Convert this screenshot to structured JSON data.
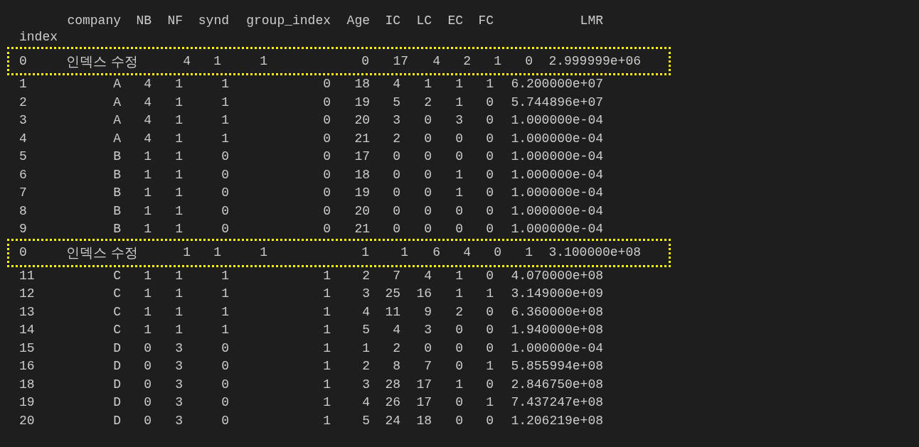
{
  "table": {
    "columns": [
      "company",
      "NB",
      "NF",
      "synd",
      "group_index",
      "Age",
      "IC",
      "LC",
      "EC",
      "FC",
      "LMR"
    ],
    "index_name": "index",
    "rows": [
      {
        "kind": "edited",
        "index": "0",
        "cells": [
          "인덱스 수정",
          "4",
          "1",
          "1",
          "0",
          "17",
          "4",
          "2",
          "1",
          "0",
          "2.999999e+06"
        ]
      },
      {
        "kind": "data",
        "index": "1",
        "cells": [
          "A",
          "4",
          "1",
          "1",
          "0",
          "18",
          "4",
          "1",
          "1",
          "1",
          "6.200000e+07"
        ]
      },
      {
        "kind": "data",
        "index": "2",
        "cells": [
          "A",
          "4",
          "1",
          "1",
          "0",
          "19",
          "5",
          "2",
          "1",
          "0",
          "5.744896e+07"
        ]
      },
      {
        "kind": "data",
        "index": "3",
        "cells": [
          "A",
          "4",
          "1",
          "1",
          "0",
          "20",
          "3",
          "0",
          "3",
          "0",
          "1.000000e-04"
        ]
      },
      {
        "kind": "data",
        "index": "4",
        "cells": [
          "A",
          "4",
          "1",
          "1",
          "0",
          "21",
          "2",
          "0",
          "0",
          "0",
          "1.000000e-04"
        ]
      },
      {
        "kind": "data",
        "index": "5",
        "cells": [
          "B",
          "1",
          "1",
          "0",
          "0",
          "17",
          "0",
          "0",
          "0",
          "0",
          "1.000000e-04"
        ]
      },
      {
        "kind": "data",
        "index": "6",
        "cells": [
          "B",
          "1",
          "1",
          "0",
          "0",
          "18",
          "0",
          "0",
          "1",
          "0",
          "1.000000e-04"
        ]
      },
      {
        "kind": "data",
        "index": "7",
        "cells": [
          "B",
          "1",
          "1",
          "0",
          "0",
          "19",
          "0",
          "0",
          "1",
          "0",
          "1.000000e-04"
        ]
      },
      {
        "kind": "data",
        "index": "8",
        "cells": [
          "B",
          "1",
          "1",
          "0",
          "0",
          "20",
          "0",
          "0",
          "0",
          "0",
          "1.000000e-04"
        ]
      },
      {
        "kind": "data",
        "index": "9",
        "cells": [
          "B",
          "1",
          "1",
          "0",
          "0",
          "21",
          "0",
          "0",
          "0",
          "0",
          "1.000000e-04"
        ]
      },
      {
        "kind": "edited",
        "index": "0",
        "cells": [
          "인덱스 수정",
          "1",
          "1",
          "1",
          "1",
          "1",
          "6",
          "4",
          "0",
          "1",
          "3.100000e+08"
        ]
      },
      {
        "kind": "data",
        "index": "11",
        "cells": [
          "C",
          "1",
          "1",
          "1",
          "1",
          "2",
          "7",
          "4",
          "1",
          "0",
          "4.070000e+08"
        ]
      },
      {
        "kind": "data",
        "index": "12",
        "cells": [
          "C",
          "1",
          "1",
          "1",
          "1",
          "3",
          "25",
          "16",
          "1",
          "1",
          "3.149000e+09"
        ]
      },
      {
        "kind": "data",
        "index": "13",
        "cells": [
          "C",
          "1",
          "1",
          "1",
          "1",
          "4",
          "11",
          "9",
          "2",
          "0",
          "6.360000e+08"
        ]
      },
      {
        "kind": "data",
        "index": "14",
        "cells": [
          "C",
          "1",
          "1",
          "1",
          "1",
          "5",
          "4",
          "3",
          "0",
          "0",
          "1.940000e+08"
        ]
      },
      {
        "kind": "data",
        "index": "15",
        "cells": [
          "D",
          "0",
          "3",
          "0",
          "1",
          "1",
          "2",
          "0",
          "0",
          "0",
          "1.000000e-04"
        ]
      },
      {
        "kind": "data",
        "index": "16",
        "cells": [
          "D",
          "0",
          "3",
          "0",
          "1",
          "2",
          "8",
          "7",
          "0",
          "1",
          "5.855994e+08"
        ]
      },
      {
        "kind": "data",
        "index": "18",
        "cells": [
          "D",
          "0",
          "3",
          "0",
          "1",
          "3",
          "28",
          "17",
          "1",
          "0",
          "2.846750e+08"
        ]
      },
      {
        "kind": "data",
        "index": "19",
        "cells": [
          "D",
          "0",
          "3",
          "0",
          "1",
          "4",
          "26",
          "17",
          "0",
          "1",
          "7.437247e+08"
        ]
      },
      {
        "kind": "data",
        "index": "20",
        "cells": [
          "D",
          "0",
          "3",
          "0",
          "1",
          "5",
          "24",
          "18",
          "0",
          "0",
          "1.206219e+08"
        ]
      }
    ]
  }
}
